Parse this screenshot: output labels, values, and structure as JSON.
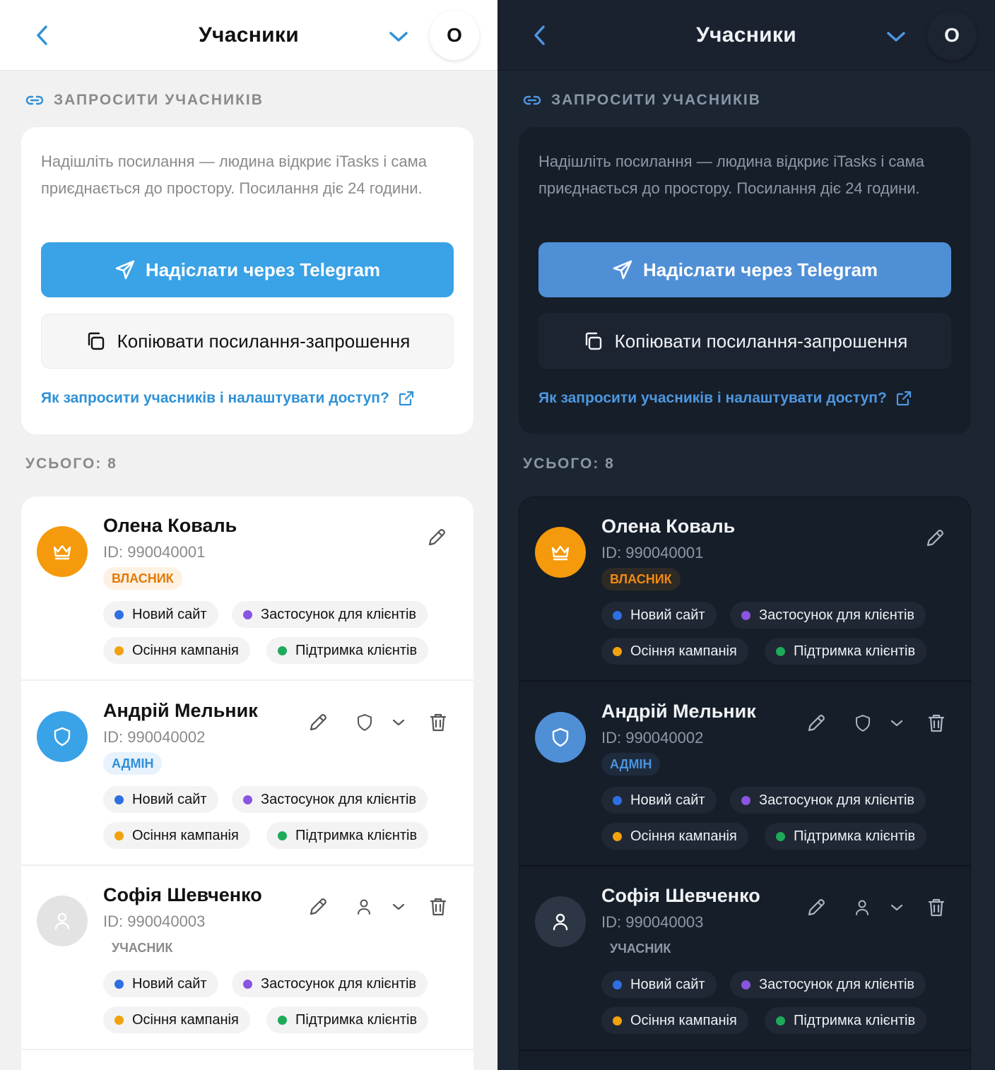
{
  "header": {
    "title": "Учасники",
    "avatar_letter": "O"
  },
  "invite": {
    "section_label": "ЗАПРОСИТИ УЧАСНИКІВ",
    "description": "Надішліть посилання — людина відкриє iTasks і сама приєднається до простору. Посилання діє 24 години.",
    "telegram_button": "Надіслати через Telegram",
    "copy_button": "Копіювати посилання-запрошення",
    "help_link": "Як запросити учасників і налаштувати доступ?"
  },
  "members": {
    "total_label": "УСЬОГО: 8",
    "list": [
      {
        "name": "Олена Коваль",
        "id": "ID: 990040001",
        "role": "ВЛАСНИК",
        "projects": [
          "Новий сайт",
          "Застосунок для клієнтів",
          "Осіння кампанія",
          "Підтримка клієнтів"
        ]
      },
      {
        "name": "Андрій Мельник",
        "id": "ID: 990040002",
        "role": "АДМІН",
        "projects": [
          "Новий сайт",
          "Застосунок для клієнтів",
          "Осіння кампанія",
          "Підтримка клієнтів"
        ]
      },
      {
        "name": "Софія Шевченко",
        "id": "ID: 990040003",
        "role": "УЧАСНИК",
        "projects": [
          "Новий сайт",
          "Застосунок для клієнтів",
          "Осіння кампанія",
          "Підтримка клієнтів"
        ]
      }
    ]
  },
  "colors": {
    "light_accent": "#3aa2e6",
    "dark_accent": "#4f8fd6",
    "owner": "#f59a0c",
    "admin": "#3aa2e6",
    "tag_blue": "#2f6fe4",
    "tag_purple": "#8a55e0",
    "tag_orange": "#f2a20f",
    "tag_green": "#1faa5b"
  },
  "icons": {
    "back": "chevron-left-icon",
    "dropdown": "chevron-down-icon",
    "link": "link-icon",
    "telegram": "send-icon",
    "copy": "copy-icon",
    "external": "external-link-icon",
    "owner": "crown-icon",
    "admin": "shield-icon",
    "member": "user-icon",
    "edit": "pencil-icon",
    "delete": "trash-icon"
  }
}
